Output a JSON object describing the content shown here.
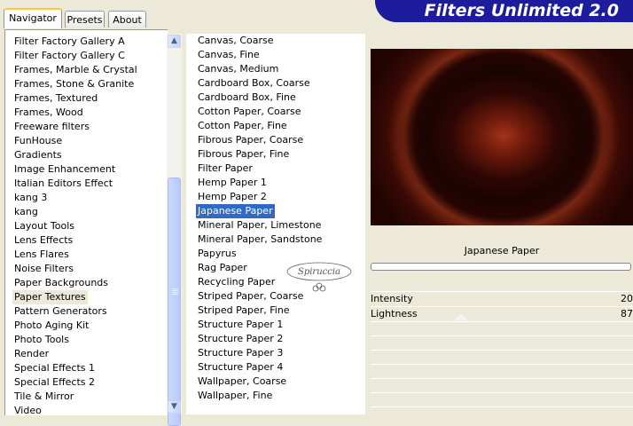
{
  "tabs": [
    {
      "label": "Navigator",
      "active": true
    },
    {
      "label": "Presets",
      "active": false
    },
    {
      "label": "About",
      "active": false
    }
  ],
  "banner": {
    "title": "Filters Unlimited 2.0",
    "color": "#1c1c9c"
  },
  "categories": {
    "items": [
      "Filter Factory Gallery A",
      "Filter Factory Gallery C",
      "Frames, Marble & Crystal",
      "Frames, Stone & Granite",
      "Frames, Textured",
      "Frames, Wood",
      "Freeware filters",
      "FunHouse",
      "Gradients",
      "Image Enhancement",
      "Italian Editors Effect",
      "kang 3",
      "kang",
      "Layout Tools",
      "Lens Effects",
      "Lens Flares",
      "Noise Filters",
      "Paper Backgrounds",
      "Paper Textures",
      "Pattern Generators",
      "Photo Aging Kit",
      "Photo Tools",
      "Render",
      "Special Effects 1",
      "Special Effects 2",
      "Tile & Mirror",
      "Video"
    ],
    "selected": "Paper Textures"
  },
  "filters": {
    "items": [
      "Canvas, Coarse",
      "Canvas, Fine",
      "Canvas, Medium",
      "Cardboard Box, Coarse",
      "Cardboard Box, Fine",
      "Cotton Paper, Coarse",
      "Cotton Paper, Fine",
      "Fibrous Paper, Coarse",
      "Fibrous Paper, Fine",
      "Filter Paper",
      "Hemp Paper 1",
      "Hemp Paper 2",
      "Japanese Paper",
      "Mineral Paper, Limestone",
      "Mineral Paper, Sandstone",
      "Papyrus",
      "Rag Paper",
      "Recycling Paper",
      "Striped Paper, Coarse",
      "Striped Paper, Fine",
      "Structure Paper 1",
      "Structure Paper 2",
      "Structure Paper 3",
      "Structure Paper 4",
      "Wallpaper, Coarse",
      "Wallpaper, Fine"
    ],
    "selected": "Japanese Paper"
  },
  "preview": {
    "filter_name": "Japanese Paper"
  },
  "parameters": [
    {
      "label": "Intensity",
      "value": "20"
    },
    {
      "label": "Lightness",
      "value": "87"
    }
  ],
  "watermark": "Spiruccia",
  "scrollbar": {
    "up_icon": "chevron-up-icon",
    "down_icon": "chevron-down-icon"
  }
}
